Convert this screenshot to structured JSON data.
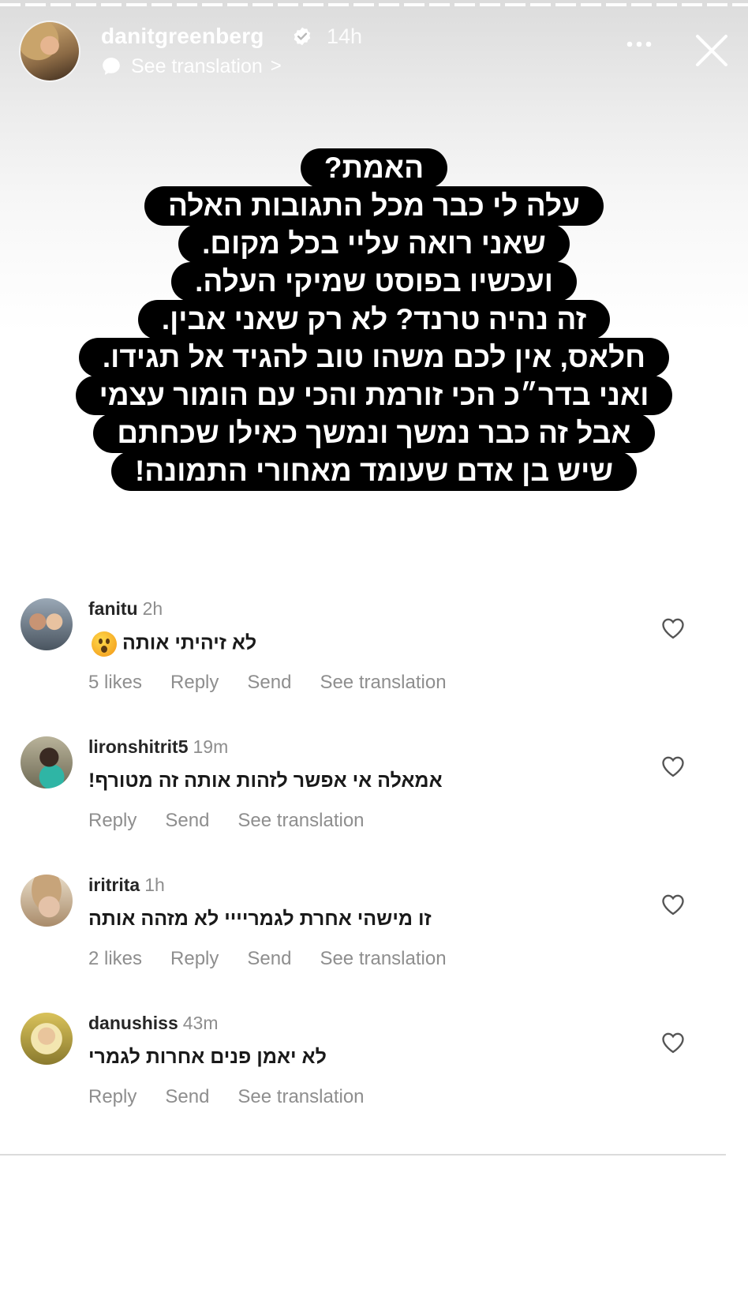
{
  "header": {
    "username": "danitgreenberg",
    "time": "14h",
    "see_translation": "See translation",
    "translate_chevron": ">"
  },
  "caption": {
    "lines": [
      "האמת?",
      "עלה לי כבר מכל התגובות האלה",
      "שאני רואה עליי בכל מקום.",
      "ועכשיו בפוסט שמיקי העלה.",
      "זה נהיה טרנד? לא רק שאני אבין.",
      "חלאס, אין לכם משהו טוב להגיד אל תגידו.",
      "ואני בדר״כ הכי זורמת והכי עם הומור עצמי",
      "אבל זה כבר נמשך ונמשך כאילו שכחתם",
      "שיש בן אדם שעומד מאחורי התמונה!"
    ]
  },
  "comments": [
    {
      "username": "fanitu",
      "time": "2h",
      "text": "לא זיהיתי אותה",
      "emoji": "astonished-face",
      "likes": "5 likes",
      "reply": "Reply",
      "send": "Send",
      "see_translation": "See translation"
    },
    {
      "username": "lironshitrit5",
      "time": "19m",
      "text": "אמאלה אי אפשר לזהות אותה זה מטורף!",
      "reply": "Reply",
      "send": "Send",
      "see_translation": "See translation"
    },
    {
      "username": "iritrita",
      "time": "1h",
      "text": "זו מישהי אחרת לגמריייי לא מזהה אותה",
      "likes": "2 likes",
      "reply": "Reply",
      "send": "Send",
      "see_translation": "See translation"
    },
    {
      "username": "danushiss",
      "time": "43m",
      "text": "לא יאמן פנים אחרות לגמרי",
      "reply": "Reply",
      "send": "Send",
      "see_translation": "See translation"
    }
  ],
  "colors": {
    "caption_bg": "#000000",
    "caption_text": "#ffffff",
    "meta_gray": "#8e8e8e",
    "text_dark": "#262626"
  },
  "icons": [
    "verified-badge-icon",
    "translate-icon",
    "more-icon",
    "close-icon",
    "heart-icon"
  ]
}
